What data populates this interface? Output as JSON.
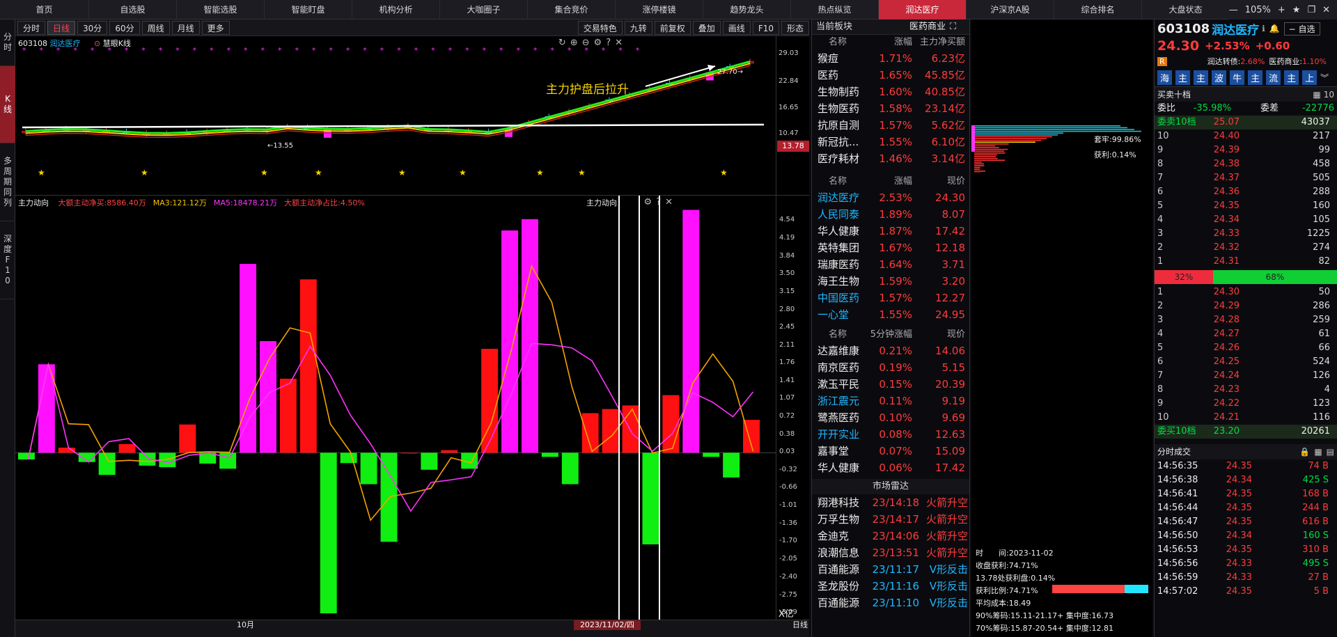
{
  "nav": {
    "tabs": [
      "首页",
      "自选股",
      "智能选股",
      "智能盯盘",
      "机构分析",
      "大咖圈子",
      "集合竞价",
      "涨停楼镜",
      "趋势龙头",
      "热点纵览",
      "润达医疗",
      "沪深京A股",
      "综合排名",
      "大盘状态"
    ],
    "active": 10,
    "zoom": "105%"
  },
  "leftbar": [
    "分时",
    "K线",
    "多周期同列",
    "深度F10"
  ],
  "toolbar": {
    "left": [
      "分时",
      "日线",
      "30分",
      "60分",
      "周线",
      "月线",
      "更多"
    ],
    "active": 1,
    "right": [
      "交易特色",
      "九转",
      "前复权",
      "叠加",
      "画线",
      "F10",
      "形态"
    ]
  },
  "kline": {
    "code": "603108",
    "name": "润达医疗",
    "indicator": "慧眼K线",
    "annotation": "主力护盘后拉升",
    "low_label": "←13.55",
    "high_label": "27.70→",
    "y_labels": [
      "29.03",
      "22.84",
      "16.65",
      "10.47"
    ],
    "cur_price_tag": "13.78"
  },
  "ind": {
    "title": "主力动向",
    "legend": [
      {
        "t": "大额主动净买:8586.40万",
        "c": "#ff4444"
      },
      {
        "t": "MA3:121.12万",
        "c": "#f5c400"
      },
      {
        "t": "MA5:18478.21万",
        "c": "#ff33ff"
      },
      {
        "t": "大额主动净占比:4.50%",
        "c": "#ff4444"
      }
    ],
    "right_title": "主力动向",
    "y_labels": [
      "4.54",
      "4.19",
      "3.84",
      "3.50",
      "3.15",
      "2.80",
      "2.45",
      "2.11",
      "1.76",
      "1.41",
      "1.07",
      "0.72",
      "0.38",
      "0.03",
      "-0.32",
      "-0.66",
      "-1.01",
      "-1.36",
      "-1.70",
      "-2.05",
      "-2.40",
      "-2.75",
      "-3.09"
    ],
    "unit": "X亿",
    "x_month": "10月",
    "x_date": "2023/11/02/四",
    "bottom_right": "日线"
  },
  "bars": [
    -0.1,
    1.75,
    0.13,
    -0.15,
    -0.4,
    0.2,
    -0.22,
    -0.25,
    0.58,
    -0.18,
    -0.28,
    3.7,
    2.2,
    1.47,
    3.4,
    -3.09,
    -0.17,
    -0.58,
    -1.7,
    0.02,
    -0.3,
    0.08,
    -0.28,
    2.05,
    4.35,
    4.57,
    -0.05,
    -0.58,
    0.8,
    0.88,
    0.95,
    -1.75,
    1.15,
    4.75,
    -0.05,
    -0.45,
    0.67
  ],
  "bar_colors": [
    "g",
    "m",
    "r",
    "g",
    "g",
    "r",
    "g",
    "g",
    "r",
    "g",
    "g",
    "m",
    "m",
    "r",
    "r",
    "g",
    "g",
    "g",
    "g",
    "r",
    "g",
    "r",
    "g",
    "r",
    "m",
    "m",
    "g",
    "g",
    "r",
    "r",
    "r",
    "g",
    "r",
    "m",
    "g",
    "g",
    "r"
  ],
  "sectors": {
    "title": "当前板块",
    "tag": "医药商业",
    "head": [
      "名称",
      "涨幅",
      "主力净买额"
    ],
    "rows": [
      [
        "猴痘",
        "1.71%",
        "6.23亿"
      ],
      [
        "医药",
        "1.65%",
        "45.85亿"
      ],
      [
        "生物制药",
        "1.60%",
        "40.85亿"
      ],
      [
        "生物医药",
        "1.58%",
        "23.14亿"
      ],
      [
        "抗原自测",
        "1.57%",
        "5.62亿"
      ],
      [
        "新冠抗...",
        "1.55%",
        "6.10亿"
      ],
      [
        "医疗耗材",
        "1.46%",
        "3.14亿"
      ]
    ],
    "head2": [
      "名称",
      "涨幅",
      "现价"
    ],
    "rows2": [
      [
        "润达医疗",
        "2.53%",
        "24.30",
        "c"
      ],
      [
        "人民同泰",
        "1.89%",
        "8.07",
        "c"
      ],
      [
        "华人健康",
        "1.87%",
        "17.42",
        "w"
      ],
      [
        "英特集团",
        "1.67%",
        "12.18",
        "w"
      ],
      [
        "瑞康医药",
        "1.64%",
        "3.71",
        "w"
      ],
      [
        "海王生物",
        "1.59%",
        "3.20",
        "w"
      ],
      [
        "中国医药",
        "1.57%",
        "12.27",
        "c"
      ],
      [
        "一心堂",
        "1.55%",
        "24.95",
        "c"
      ]
    ],
    "head3": [
      "名称",
      "5分钟涨幅",
      "现价"
    ],
    "rows3": [
      [
        "达嘉维康",
        "0.21%",
        "14.06",
        "w"
      ],
      [
        "南京医药",
        "0.19%",
        "5.15",
        "w"
      ],
      [
        "漱玉平民",
        "0.15%",
        "20.39",
        "w"
      ],
      [
        "浙江震元",
        "0.11%",
        "9.19",
        "c"
      ],
      [
        "鹭燕医药",
        "0.10%",
        "9.69",
        "w"
      ],
      [
        "开开实业",
        "0.08%",
        "12.63",
        "c"
      ],
      [
        "嘉事堂",
        "0.07%",
        "15.09",
        "w"
      ],
      [
        "华人健康",
        "0.06%",
        "17.42",
        "w"
      ]
    ],
    "radar_title": "市场雷达",
    "radar": [
      [
        "翔港科技",
        "23/14:18",
        "火箭升空",
        "r"
      ],
      [
        "万孚生物",
        "23/14:17",
        "火箭升空",
        "r"
      ],
      [
        "金迪克",
        "23/14:06",
        "火箭升空",
        "r"
      ],
      [
        "浪潮信息",
        "23/13:51",
        "火箭升空",
        "r"
      ],
      [
        "百通能源",
        "23/11:17",
        "V形反击",
        "c"
      ],
      [
        "圣龙股份",
        "23/11:16",
        "V形反击",
        "c"
      ],
      [
        "百通能源",
        "23/11:10",
        "V形反击",
        "c"
      ]
    ]
  },
  "chips": {
    "hold": "套牢:99.86%",
    "profit": "获利:0.14%",
    "info": [
      "时　　间:2023-11-02",
      "收盘获利:74.71%",
      "13.78处获利盘:0.14%",
      "获利比例:74.71%",
      "平均成本:18.49",
      "90%筹码:15.11-21.17+ 集中度:16.73",
      "70%筹码:15.87-20.54+ 集中度:12.81"
    ]
  },
  "quote": {
    "code": "603108",
    "name": "润达医疗",
    "price": "24.30",
    "pct": "+2.53%",
    "chg": "+0.60",
    "self": "自选",
    "conv_label": "润达转债:",
    "conv_val": "2.68%",
    "ind_label": "医药商业:",
    "ind_val": "1.10%",
    "markets": [
      "海",
      "主",
      "主",
      "波",
      "牛",
      "主",
      "流",
      "主",
      "上"
    ],
    "book_title": "买卖十档",
    "webi_l": "委比",
    "webi": "-35.98%",
    "wecha_l": "委差",
    "wecha": "-22776",
    "sell10_l": "委卖10档",
    "sell10_p": "25.07",
    "sell10_v": "43037",
    "asks": [
      [
        "10",
        "24.40",
        "217"
      ],
      [
        "9",
        "24.39",
        "99"
      ],
      [
        "8",
        "24.38",
        "458"
      ],
      [
        "7",
        "24.37",
        "505"
      ],
      [
        "6",
        "24.36",
        "288"
      ],
      [
        "5",
        "24.35",
        "160"
      ],
      [
        "4",
        "24.34",
        "105"
      ],
      [
        "3",
        "24.33",
        "1225"
      ],
      [
        "2",
        "24.32",
        "274"
      ],
      [
        "1",
        "24.31",
        "82"
      ]
    ],
    "ratio_l": "32%",
    "ratio_r": "68%",
    "ratio": 0.32,
    "bids": [
      [
        "1",
        "24.30",
        "50"
      ],
      [
        "2",
        "24.29",
        "286"
      ],
      [
        "3",
        "24.28",
        "259"
      ],
      [
        "4",
        "24.27",
        "61"
      ],
      [
        "5",
        "24.26",
        "66"
      ],
      [
        "6",
        "24.25",
        "524"
      ],
      [
        "7",
        "24.24",
        "126"
      ],
      [
        "8",
        "24.23",
        "4"
      ],
      [
        "9",
        "24.22",
        "123"
      ],
      [
        "10",
        "24.21",
        "116"
      ]
    ],
    "buy10_l": "委买10档",
    "buy10_p": "23.20",
    "buy10_v": "20261",
    "trades_title": "分时成交",
    "trades": [
      [
        "14:56:35",
        "24.35",
        "74 B"
      ],
      [
        "14:56:38",
        "24.34",
        "425 S"
      ],
      [
        "14:56:41",
        "24.35",
        "168 B"
      ],
      [
        "14:56:44",
        "24.35",
        "244 B"
      ],
      [
        "14:56:47",
        "24.35",
        "616 B"
      ],
      [
        "14:56:50",
        "24.34",
        "160 S"
      ],
      [
        "14:56:53",
        "24.35",
        "310 B"
      ],
      [
        "14:56:56",
        "24.33",
        "495 S"
      ],
      [
        "14:56:59",
        "24.33",
        "27 B"
      ],
      [
        "14:57:02",
        "24.35",
        "5 B"
      ]
    ]
  }
}
